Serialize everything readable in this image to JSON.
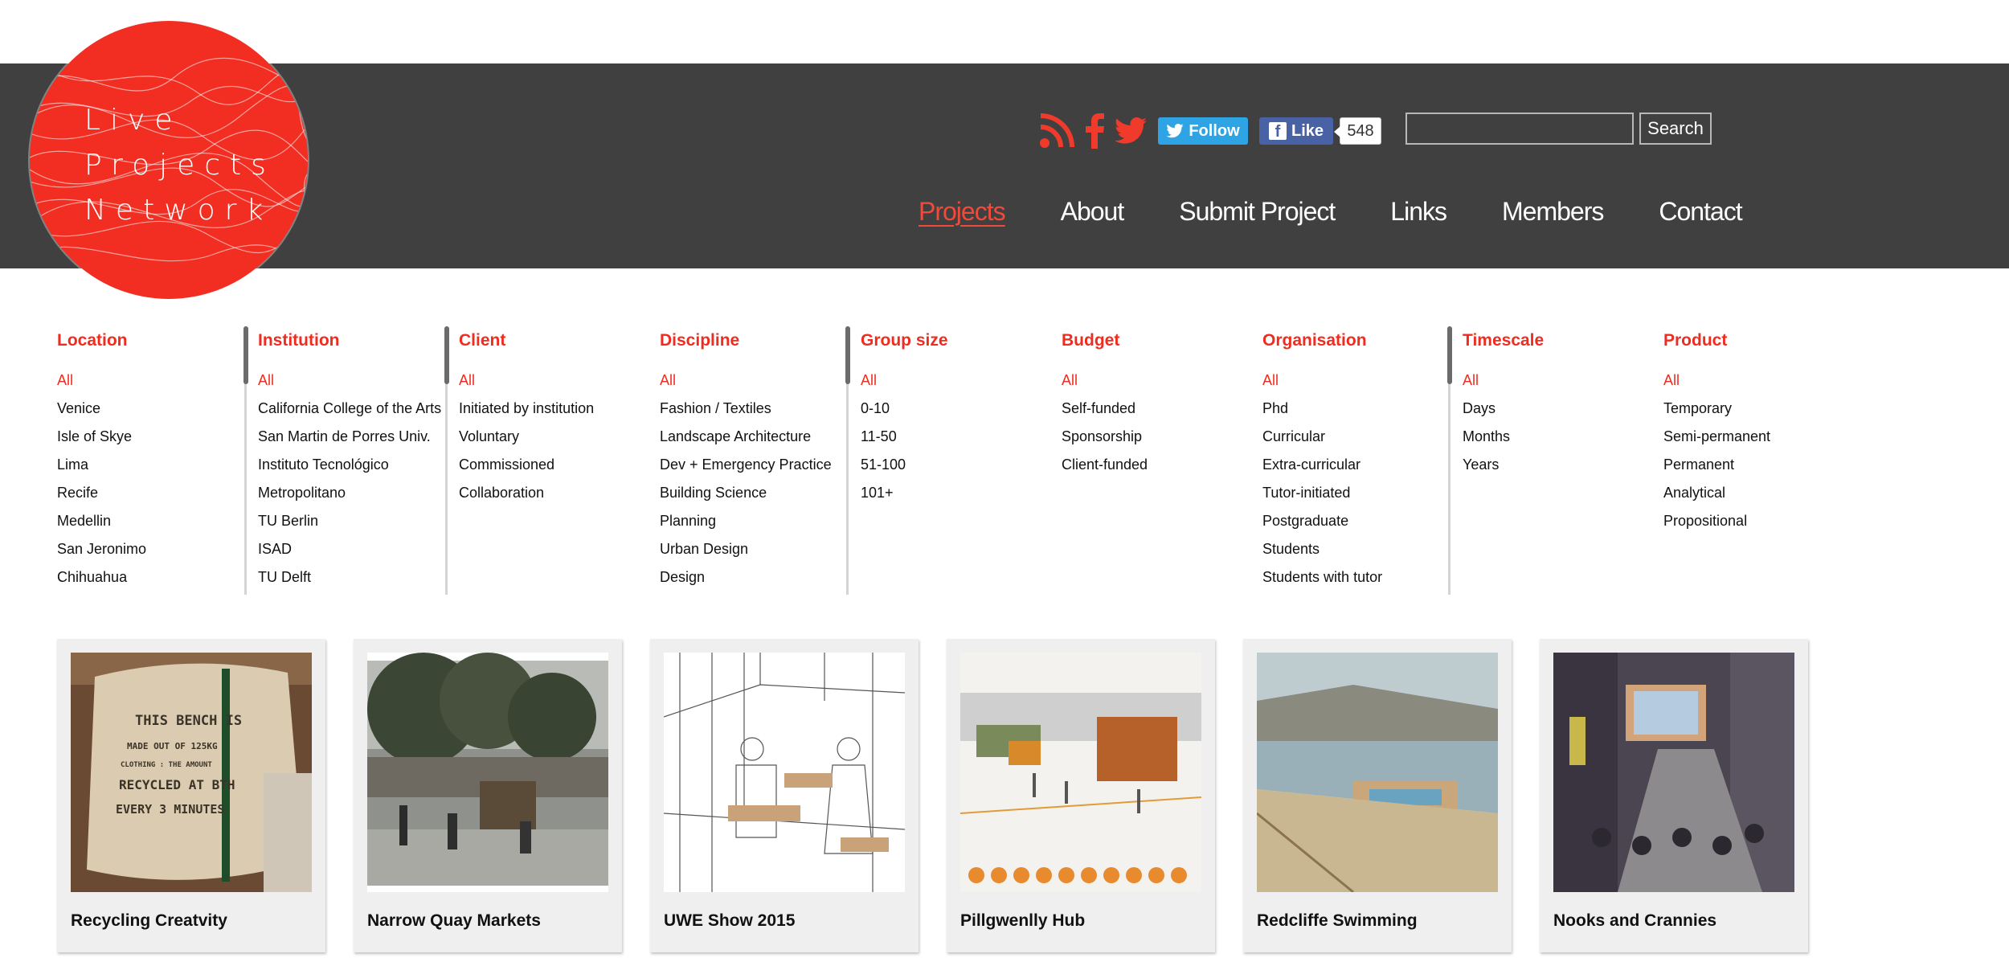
{
  "logo": {
    "lines": [
      "Live",
      "Projects",
      "Network"
    ],
    "color": "#f22e22"
  },
  "social": {
    "icons": [
      "rss-icon",
      "facebook-icon",
      "twitter-icon"
    ],
    "follow_label": "Follow",
    "like_label": "Like",
    "like_count": "548"
  },
  "search": {
    "placeholder": "",
    "button_label": "Search"
  },
  "nav": [
    {
      "label": "Projects",
      "active": true
    },
    {
      "label": "About"
    },
    {
      "label": "Submit Project"
    },
    {
      "label": "Links"
    },
    {
      "label": "Members"
    },
    {
      "label": "Contact"
    }
  ],
  "filters": [
    {
      "title": "Location",
      "items": [
        "All",
        "Venice",
        "Isle of Skye",
        "Lima",
        "Recife",
        "Medellin",
        "San Jeronimo",
        "Chihuahua"
      ]
    },
    {
      "title": "Institution",
      "items": [
        "All",
        "California College of the Arts",
        "San Martin de Porres Univ.",
        "Instituto Tecnológico",
        "Metropolitano",
        "TU Berlin",
        "ISAD",
        "TU Delft"
      ]
    },
    {
      "title": "Client",
      "items": [
        "All",
        "Initiated by institution",
        "Voluntary",
        "Commissioned",
        "Collaboration"
      ]
    },
    {
      "title": "Discipline",
      "items": [
        "All",
        "Fashion / Textiles",
        "Landscape Architecture",
        "Dev + Emergency Practice",
        "Building Science",
        "Planning",
        "Urban Design",
        "Design"
      ]
    },
    {
      "title": "Group size",
      "items": [
        "All",
        "0-10",
        "11-50",
        "51-100",
        "101+"
      ]
    },
    {
      "title": "Budget",
      "items": [
        "All",
        "Self-funded",
        "Sponsorship",
        "Client-funded"
      ]
    },
    {
      "title": "Organisation",
      "items": [
        "All",
        "Phd",
        "Curricular",
        "Extra-curricular",
        "Tutor-initiated",
        "Postgraduate",
        "Students",
        "Students with tutor"
      ]
    },
    {
      "title": "Timescale",
      "items": [
        "All",
        "Days",
        "Months",
        "Years"
      ]
    },
    {
      "title": "Product",
      "items": [
        "All",
        "Temporary",
        "Semi-permanent",
        "Permanent",
        "Analytical",
        "Propositional"
      ]
    }
  ],
  "projects": [
    {
      "title": "Recycling Creatvity",
      "image_text": [
        "THIS BENCH IS",
        "MADE OUT OF 125KG",
        "CLOTHING : THE AMOUNT",
        "RECYCLED AT BTH",
        "EVERY 3 MINUTES"
      ]
    },
    {
      "title": "Narrow Quay Markets"
    },
    {
      "title": "UWE Show 2015"
    },
    {
      "title": "Pillgwenlly Hub"
    },
    {
      "title": "Redcliffe Swimming"
    },
    {
      "title": "Nooks and Crannies"
    }
  ],
  "colors": {
    "accent": "#ee2d20",
    "header_bg": "#404040",
    "card_bg": "#efefef",
    "twitter": "#2ea4e4",
    "facebook": "#4962a6"
  }
}
